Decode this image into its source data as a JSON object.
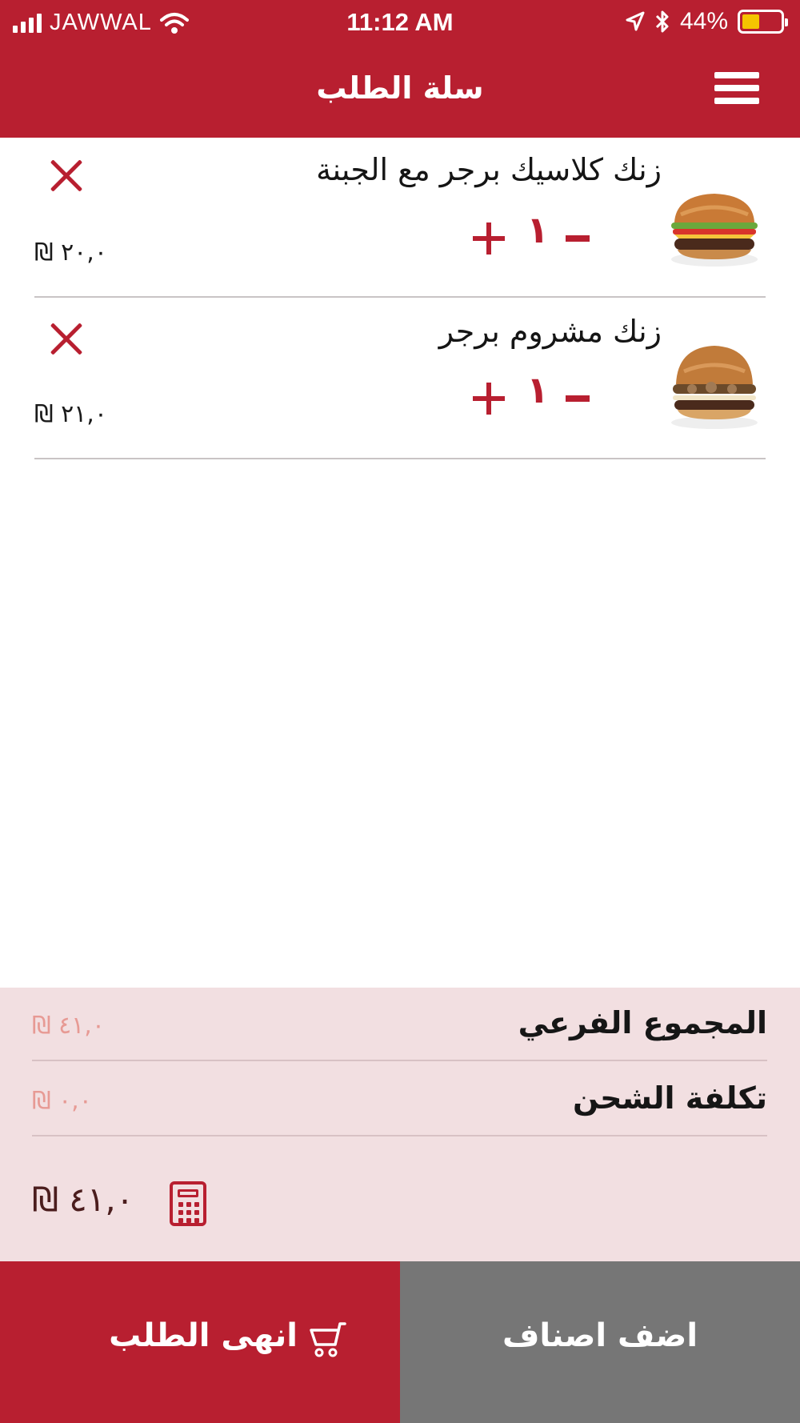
{
  "status_bar": {
    "carrier": "JAWWAL",
    "time": "11:12 AM",
    "battery": "44%"
  },
  "header": {
    "title": "سلة الطلب"
  },
  "cart": {
    "items": [
      {
        "name": "زنك كلاسيك برجر مع الجبنة",
        "quantity": "١",
        "price": "₪ ٢٠,٠"
      },
      {
        "name": "زنك مشروم برجر",
        "quantity": "١",
        "price": "₪ ٢١,٠"
      }
    ]
  },
  "summary": {
    "subtotal_label": "المجموع الفرعي",
    "subtotal_value": "₪ ٤١,٠",
    "shipping_label": "تكلفة الشحن",
    "shipping_value": "₪ ٠,٠",
    "total_value": "₪ ٤١,٠"
  },
  "actions": {
    "finish_label": "انهى الطلب",
    "add_label": "اضف اصناف"
  },
  "colors": {
    "brand_red": "#b81f30",
    "summary_bg": "#f2dfe1",
    "secondary_button": "#767676"
  },
  "icons": [
    "menu-icon",
    "close-icon",
    "calculator-icon",
    "cart-icon",
    "wifi-icon",
    "location-icon",
    "bluetooth-icon",
    "battery-icon"
  ]
}
